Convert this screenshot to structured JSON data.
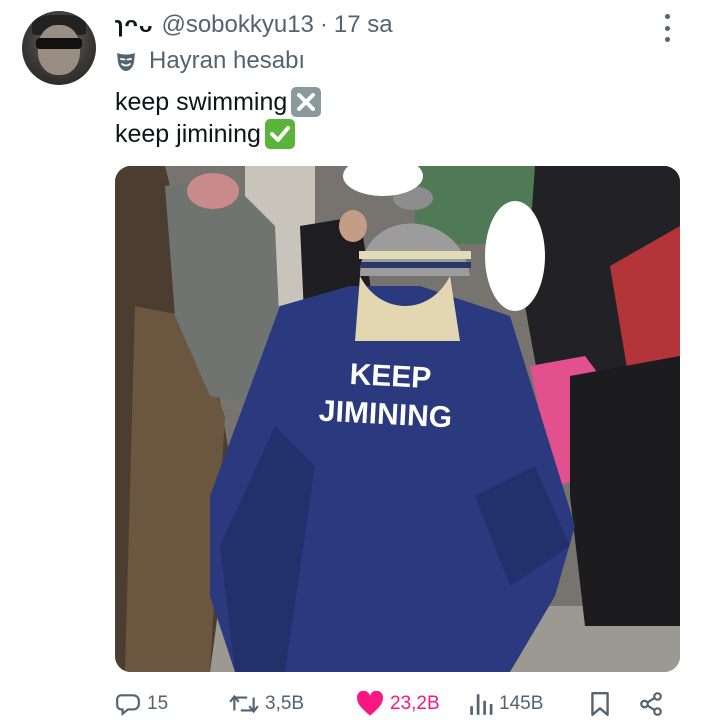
{
  "tweet": {
    "display_name": "ɿᴖᴗ",
    "handle": "@sobokkyu13",
    "separator": "·",
    "time": "17 sa",
    "fan_label": "Hayran hesabı",
    "lines": [
      "keep swimming",
      "keep jimining"
    ],
    "emojis": [
      "cross-mark-emoji",
      "check-mark-emoji"
    ]
  },
  "photo": {
    "jacket_text_line1": "KEEP",
    "jacket_text_line2": "JIMINING",
    "jacket_color": "#2b3a7e"
  },
  "actions": {
    "reply_count": "15",
    "retweet_count": "3,5B",
    "like_count": "23,2B",
    "view_count": "145B",
    "like_color": "#f91880",
    "muted_color": "#536471"
  },
  "icons": [
    "more-icon",
    "mask-icon",
    "reply-icon",
    "retweet-icon",
    "heart-icon",
    "views-icon",
    "bookmark-icon",
    "share-icon"
  ]
}
